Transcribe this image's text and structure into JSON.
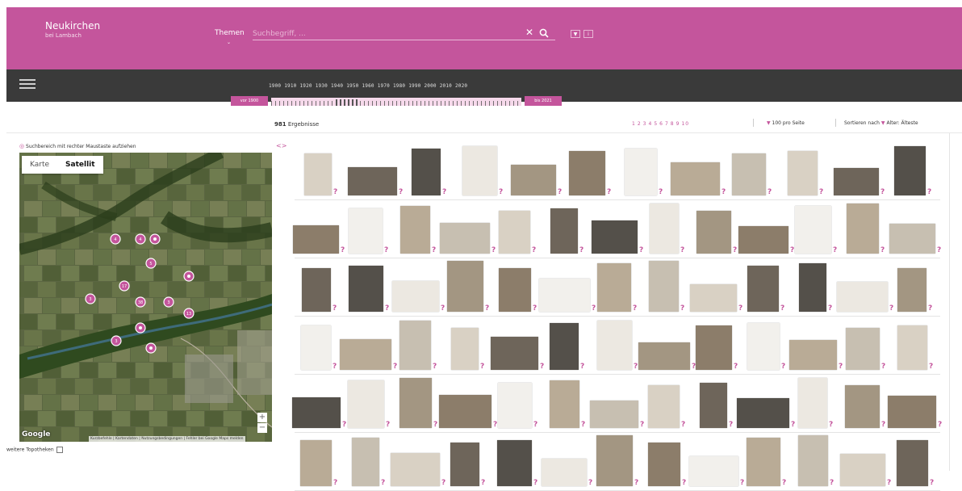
{
  "header": {
    "title": "Neukirchen",
    "subtitle": "bei Lambach",
    "themen_label": "Themen",
    "search_placeholder": "Suchbegriff, ...",
    "clear_icon": "close-icon",
    "search_icon": "search-icon",
    "bg_color": "#c4559c"
  },
  "timeline": {
    "years": [
      "1900",
      "1910",
      "1920",
      "1930",
      "1940",
      "1950",
      "1960",
      "1970",
      "1980",
      "1990",
      "2000",
      "2010",
      "2020"
    ],
    "from_label": "vor 1900",
    "to_label": "bis 2021"
  },
  "results": {
    "count": "981",
    "count_label": "Ergebnisse",
    "pages": [
      "1",
      "2",
      "3",
      "4",
      "5",
      "6",
      "7",
      "8",
      "9",
      "10"
    ],
    "per_page": "100 pro Seite",
    "sort_label": "Sortieren nach",
    "sort_value": "Alter: Älteste"
  },
  "map": {
    "note": "Suchbereich mit rechter Maustaste aufziehen",
    "tab_karte": "Karte",
    "tab_satellit": "Satellit",
    "zoom_in": "+",
    "zoom_out": "−",
    "google_label": "Google",
    "footer": "Kurzbefehle | Kartendaten | Nutzungsbedingungen | Fehler bei Google Maps melden",
    "markers": [
      "4",
      "4",
      "",
      "5",
      "",
      "17",
      "3",
      "38",
      "3",
      "13",
      "",
      "3",
      ""
    ]
  },
  "sidebar": {
    "topotheken_label": "weitere Topotheken"
  },
  "grid": {
    "unknown_marker": "?",
    "accent": "#c4559c"
  }
}
